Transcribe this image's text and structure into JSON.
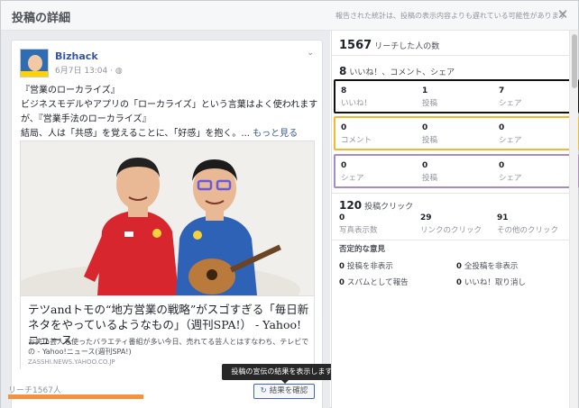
{
  "header": {
    "title": "投稿の詳細",
    "notice": "報告された統計は、投稿の表示内容よりも遅れている可能性があります",
    "close_icon": "close-icon"
  },
  "post": {
    "page_name": "Bizhack",
    "meta": "6月7日 13:04 · ",
    "privacy_icon": "globe-icon",
    "menu_icon": "chevron-down-icon",
    "text_line1": "『営業のローカライズ』",
    "text_line2": "ビジネスモデルやアプリの「ローカライズ」という言葉はよく使われます",
    "text_line3": "が、『営業手法のローカライズ』",
    "text_line4": "結局、人は「共感」を覚えることに、「好感」を抱く。... ",
    "see_more": "もっと見る",
    "link": {
      "title": "テツandトモの“地方営業の戦略”がスゴすぎる「毎日新ネタをやっているようなもの」（週刊SPA!） - Yahoo!ニュース",
      "description": "お笑い芸人を使ったバラエティ番組が多い今日、売れてる芸人とはすなわち、テレビでの - Yahoo!ニュース(週刊SPA!)",
      "domain": "ZASSHI.NEWS.YAHOO.CO.JP"
    },
    "reach_label": "リーチ1567人",
    "reach_fraction": 1.0,
    "tooltip": "投稿の宣伝の結果を表示します。",
    "result_button": "結果を確認",
    "result_icon": "refresh-icon"
  },
  "stats": {
    "reach_value": "1567",
    "reach_label": "リーチした人の数",
    "engagement_value": "8",
    "engagement_label": "いいね！、コメント、シェア",
    "row1": [
      {
        "value": "8",
        "label": "いいね！"
      },
      {
        "value": "1",
        "label": "投稿"
      },
      {
        "value": "7",
        "label": "シェア"
      }
    ],
    "row2": [
      {
        "value": "0",
        "label": "コメント"
      },
      {
        "value": "0",
        "label": "投稿"
      },
      {
        "value": "0",
        "label": "シェア"
      }
    ],
    "row3": [
      {
        "value": "0",
        "label": "シェア"
      },
      {
        "value": "0",
        "label": "投稿"
      },
      {
        "value": "0",
        "label": "シェア"
      }
    ],
    "clicks_value": "120",
    "clicks_label": "投稿クリック",
    "clicks": [
      {
        "value": "0",
        "label": "写真表示数"
      },
      {
        "value": "29",
        "label": "リンクのクリック"
      },
      {
        "value": "91",
        "label": "その他のクリック"
      }
    ],
    "negative_title": "否定的な意見",
    "negative": [
      {
        "value": "0",
        "label": "投稿を非表示"
      },
      {
        "value": "0",
        "label": "全投稿を非表示"
      },
      {
        "value": "0",
        "label": "スパムとして報告"
      },
      {
        "value": "0",
        "label": "いいね！取り消し"
      }
    ]
  },
  "colors": {
    "box1": "#111111",
    "box2": "#f5b731",
    "box3": "#a78bc2",
    "reach_bar": "#f7923b",
    "accent": "#4267b2"
  }
}
